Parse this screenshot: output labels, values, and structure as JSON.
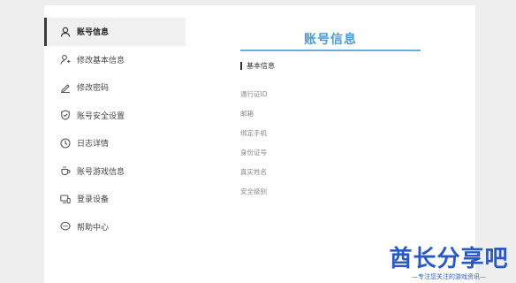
{
  "sidebar": {
    "items": [
      {
        "label": "账号信息",
        "icon": "user-icon",
        "active": true
      },
      {
        "label": "修改基本信息",
        "icon": "user-edit-icon",
        "active": false
      },
      {
        "label": "修改密码",
        "icon": "pen-icon",
        "active": false
      },
      {
        "label": "账号安全设置",
        "icon": "shield-icon",
        "active": false
      },
      {
        "label": "日志详情",
        "icon": "clock-icon",
        "active": false
      },
      {
        "label": "账号游戏信息",
        "icon": "cup-icon",
        "active": false
      },
      {
        "label": "登录设备",
        "icon": "devices-icon",
        "active": false
      },
      {
        "label": "帮助中心",
        "icon": "help-chat-icon",
        "active": false
      }
    ]
  },
  "main": {
    "title": "账号信息",
    "section": "基本信息",
    "fields": [
      "通行证ID",
      "邮箱",
      "绑定手机",
      "身份证号",
      "真实姓名",
      "安全级别"
    ]
  },
  "watermark": {
    "logo": "酋长分享吧",
    "tagline": "—专注您关注的游戏资讯—"
  },
  "colors": {
    "accent": "#4a9bd2",
    "watermark": "#2b59c3"
  }
}
